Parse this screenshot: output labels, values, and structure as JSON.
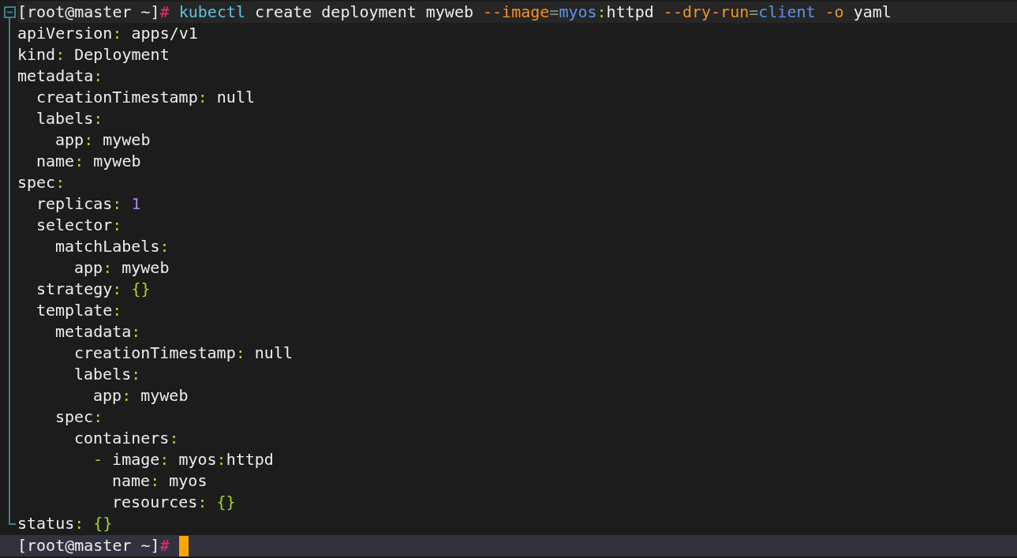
{
  "yaml_syntax": {
    "separator": ":",
    "list_marker": "-"
  },
  "command": [
    {
      "text": "[root@master ~]",
      "kind": "plain"
    },
    {
      "text": "#",
      "kind": "hash"
    },
    {
      "text": " kubectl",
      "kind": "program"
    },
    {
      "text": " create deployment myweb ",
      "kind": "plain"
    },
    {
      "text": "--image",
      "kind": "flag"
    },
    {
      "text": "=",
      "kind": "operator"
    },
    {
      "text": "myos",
      "kind": "value"
    },
    {
      "text": ":",
      "kind": "punct"
    },
    {
      "text": "httpd ",
      "kind": "plain"
    },
    {
      "text": "--dry-run",
      "kind": "flag"
    },
    {
      "text": "=",
      "kind": "operator"
    },
    {
      "text": "client ",
      "kind": "value"
    },
    {
      "text": "-o",
      "kind": "flag"
    },
    {
      "text": " yaml",
      "kind": "plain"
    }
  ],
  "yaml": [
    {
      "key": "apiVersion",
      "value": [
        {
          "text": "apps/v1",
          "kind": "plain"
        }
      ]
    },
    {
      "key": "kind",
      "value": [
        {
          "text": "Deployment",
          "kind": "plain"
        }
      ]
    },
    {
      "key": "metadata",
      "children": [
        {
          "key": "creationTimestamp",
          "value": [
            {
              "text": "null",
              "kind": "plain"
            }
          ]
        },
        {
          "key": "labels",
          "children": [
            {
              "key": "app",
              "value": [
                {
                  "text": "myweb",
                  "kind": "plain"
                }
              ]
            }
          ]
        },
        {
          "key": "name",
          "value": [
            {
              "text": "myweb",
              "kind": "plain"
            }
          ]
        }
      ]
    },
    {
      "key": "spec",
      "children": [
        {
          "key": "replicas",
          "value": [
            {
              "text": "1",
              "kind": "number"
            }
          ]
        },
        {
          "key": "selector",
          "children": [
            {
              "key": "matchLabels",
              "children": [
                {
                  "key": "app",
                  "value": [
                    {
                      "text": "myweb",
                      "kind": "plain"
                    }
                  ]
                }
              ]
            }
          ]
        },
        {
          "key": "strategy",
          "value": [
            {
              "text": "{}",
              "kind": "punct"
            }
          ]
        },
        {
          "key": "template",
          "children": [
            {
              "key": "metadata",
              "children": [
                {
                  "key": "creationTimestamp",
                  "value": [
                    {
                      "text": "null",
                      "kind": "plain"
                    }
                  ]
                },
                {
                  "key": "labels",
                  "children": [
                    {
                      "key": "app",
                      "value": [
                        {
                          "text": "myweb",
                          "kind": "plain"
                        }
                      ]
                    }
                  ]
                }
              ]
            },
            {
              "key": "spec",
              "children": [
                {
                  "key": "containers",
                  "items": [
                    [
                      {
                        "key": "image",
                        "value": [
                          {
                            "text": "myos",
                            "kind": "plain"
                          },
                          {
                            "text": ":",
                            "kind": "punct"
                          },
                          {
                            "text": "httpd",
                            "kind": "plain"
                          }
                        ]
                      },
                      {
                        "key": "name",
                        "value": [
                          {
                            "text": "myos",
                            "kind": "plain"
                          }
                        ]
                      },
                      {
                        "key": "resources",
                        "value": [
                          {
                            "text": "{}",
                            "kind": "punct"
                          }
                        ]
                      }
                    ]
                  ]
                }
              ]
            }
          ]
        }
      ]
    },
    {
      "key": "status",
      "value": [
        {
          "text": "{}",
          "kind": "punct"
        }
      ]
    }
  ],
  "prompt": [
    {
      "text": "[root@master ~]",
      "kind": "plain"
    },
    {
      "text": "#",
      "kind": "hash"
    }
  ]
}
